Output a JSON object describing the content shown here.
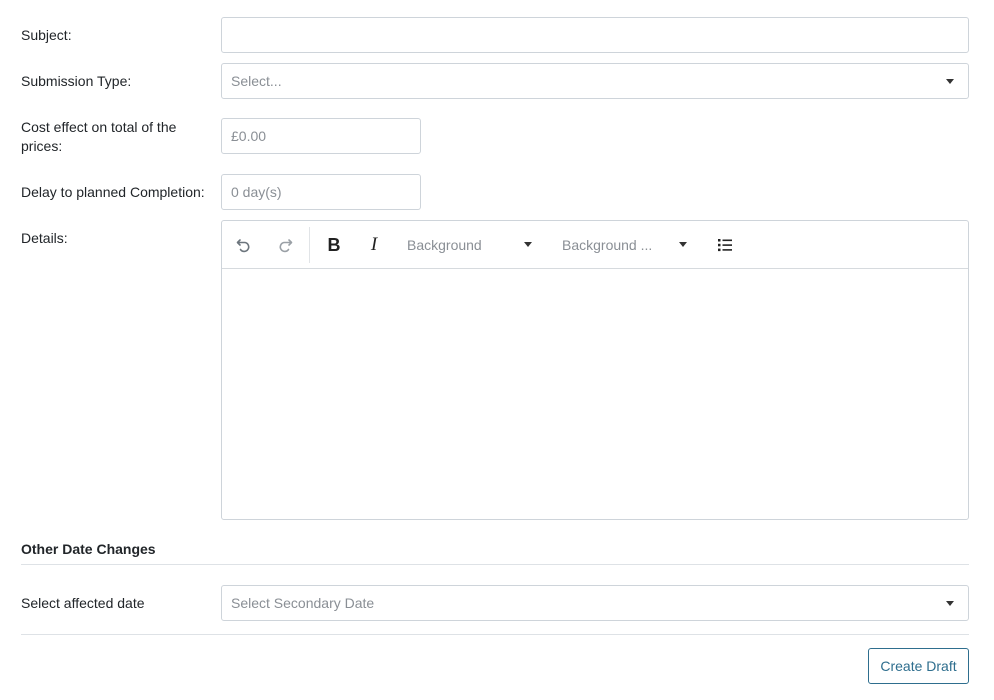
{
  "form": {
    "subject": {
      "label": "Subject:",
      "value": ""
    },
    "submission_type": {
      "label": "Submission Type:",
      "placeholder": "Select..."
    },
    "cost_effect": {
      "label_line1": "Cost effect on total of the",
      "label_line2": "prices:",
      "placeholder": "£0.00"
    },
    "delay": {
      "label": "Delay to planned Completion:",
      "placeholder": "0 day(s)"
    },
    "details": {
      "label": "Details:",
      "toolbar": {
        "undo_icon": "undo-icon",
        "redo_icon": "redo-icon",
        "bold_label": "B",
        "italic_label": "I",
        "dropdown1": "Background",
        "dropdown2": "Background ...",
        "list_icon": "bulleted-list-icon"
      },
      "content": ""
    }
  },
  "other_date_changes": {
    "title": "Other Date Changes",
    "select_affected_date": {
      "label": "Select affected date",
      "placeholder": "Select Secondary Date"
    }
  },
  "actions": {
    "create_draft": "Create Draft"
  },
  "colors": {
    "primary": "#2e6e8e",
    "border": "#ced4da",
    "placeholder": "#8a8f95"
  }
}
